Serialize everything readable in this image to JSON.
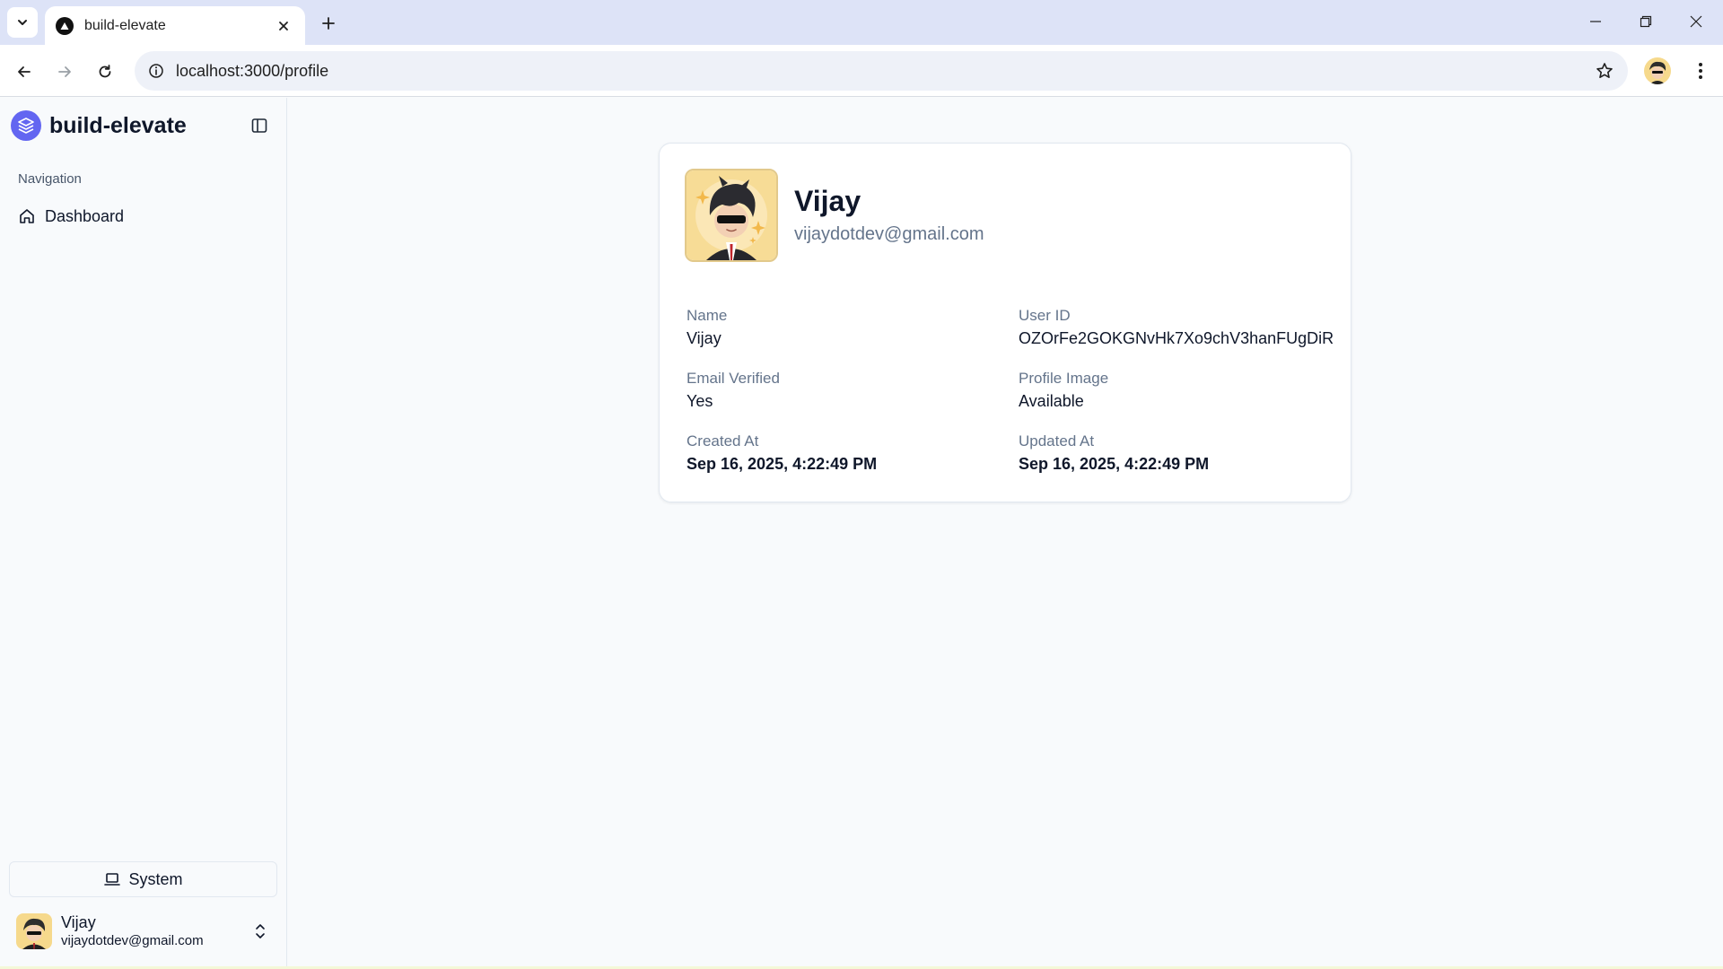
{
  "browser": {
    "tab_title": "build-elevate",
    "url": "localhost:3000/profile"
  },
  "sidebar": {
    "brand": "build-elevate",
    "nav_group_label": "Navigation",
    "items": [
      {
        "label": "Dashboard",
        "icon": "home-icon"
      }
    ],
    "theme_label": "System",
    "user": {
      "name": "Vijay",
      "email": "vijaydotdev@gmail.com"
    }
  },
  "profile": {
    "name": "Vijay",
    "email": "vijaydotdev@gmail.com",
    "fields": {
      "name": {
        "label": "Name",
        "value": "Vijay"
      },
      "user_id": {
        "label": "User ID",
        "value": "OZOrFe2GOKGNvHk7Xo9chV3hanFUgDiR"
      },
      "email_verified": {
        "label": "Email Verified",
        "value": "Yes"
      },
      "profile_image": {
        "label": "Profile Image",
        "value": "Available"
      },
      "created_at": {
        "label": "Created At",
        "value": "Sep 16, 2025, 4:22:49 PM"
      },
      "updated_at": {
        "label": "Updated At",
        "value": "Sep 16, 2025, 4:22:49 PM"
      }
    }
  },
  "colors": {
    "accent": "#6366f1",
    "tabbar": "#dde3f7",
    "background": "#f8fafc"
  }
}
